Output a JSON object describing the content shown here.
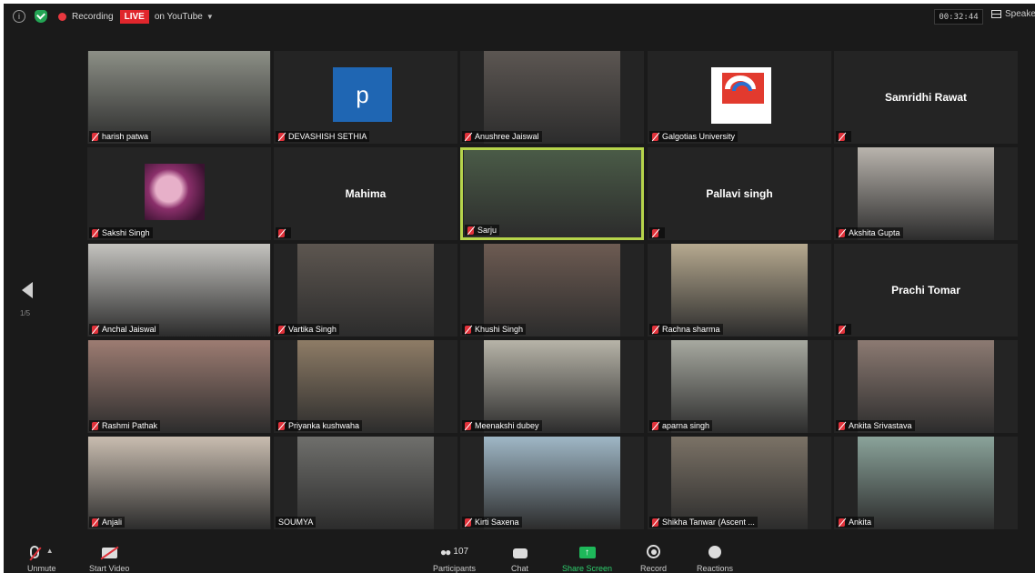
{
  "topbar": {
    "recording_label": "Recording",
    "live_badge": "LIVE",
    "live_target": "on YouTube",
    "timer": "00:32:44",
    "view_label": "Speaker"
  },
  "gallery": {
    "page_indicator": "1/5",
    "tiles": [
      {
        "name": "harish patwa",
        "type": "video",
        "bg": "#8c8f86"
      },
      {
        "name": "DEVASHISH SETHIA",
        "type": "letter",
        "avatar_letter": "p"
      },
      {
        "name": "Anushree Jaiswal",
        "type": "video",
        "bg": "#5c5652"
      },
      {
        "name": "Galgotias University",
        "type": "logo"
      },
      {
        "name": "",
        "type": "name",
        "display_name": "Samridhi Rawat"
      },
      {
        "name": "Sakshi Singh",
        "type": "image"
      },
      {
        "name": "",
        "type": "name",
        "display_name": "Mahima"
      },
      {
        "name": "Sarju",
        "type": "video",
        "bg": "#4a5b47",
        "active": true
      },
      {
        "name": "",
        "type": "name",
        "display_name": "Pallavi singh"
      },
      {
        "name": "Akshita Gupta",
        "type": "video",
        "bg": "#b9b4ad"
      },
      {
        "name": "Anchal Jaiswal",
        "type": "video",
        "bg": "#c4c3bf"
      },
      {
        "name": "Vartika Singh",
        "type": "video",
        "bg": "#5d5650"
      },
      {
        "name": "Khushi Singh",
        "type": "video",
        "bg": "#6d5b52"
      },
      {
        "name": "Rachna sharma",
        "type": "video",
        "bg": "#b6a98f"
      },
      {
        "name": "",
        "type": "name",
        "display_name": "Prachi Tomar"
      },
      {
        "name": "Rashmi Pathak",
        "type": "video",
        "bg": "#9d7c72"
      },
      {
        "name": "Priyanka kushwaha",
        "type": "video",
        "bg": "#8e7c66"
      },
      {
        "name": "Meenakshi dubey",
        "type": "video",
        "bg": "#b7b4a8"
      },
      {
        "name": "aparna singh",
        "type": "video",
        "bg": "#a7a9a0"
      },
      {
        "name": "Ankita Srivastava",
        "type": "video",
        "bg": "#8c7a72"
      },
      {
        "name": "Anjali",
        "type": "video",
        "bg": "#c9bdb0"
      },
      {
        "name": "SOUMYA",
        "type": "video",
        "bg": "#6f6f6c",
        "muted": false
      },
      {
        "name": "Kirti Saxena",
        "type": "video",
        "bg": "#9fb7c6"
      },
      {
        "name": "Shikha Tanwar (Ascent ...",
        "type": "video",
        "bg": "#7b7266"
      },
      {
        "name": "Ankita",
        "type": "video",
        "bg": "#8aa39a"
      }
    ]
  },
  "toolbar": {
    "unmute": "Unmute",
    "start_video": "Start Video",
    "participants": "Participants",
    "participants_count": "107",
    "chat": "Chat",
    "share_screen": "Share Screen",
    "record": "Record",
    "reactions": "Reactions"
  }
}
